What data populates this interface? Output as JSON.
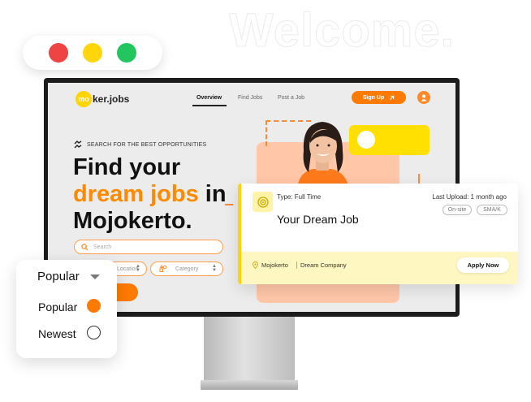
{
  "hero_banner": {
    "text": "Welcome."
  },
  "window_controls": {
    "colors": {
      "close": "#ef4444",
      "minimize": "#ffd60a",
      "maximize": "#22c55e"
    }
  },
  "app": {
    "logo": {
      "mark": "mo",
      "text": "ker.jobs"
    },
    "nav": {
      "overview": "Overview",
      "find_jobs": "Find Jobs",
      "post_job": "Post a Job"
    },
    "signup_label": "Sign Up",
    "hero": {
      "tagline": "SEARCH FOR THE BEST OPPORTUNITIES",
      "line1": "Find your",
      "highlight": "dream jobs",
      "line2_rest": " in",
      "line3": "Mojokerto."
    },
    "search": {
      "placeholder": "Search"
    },
    "filters": {
      "location": "Location",
      "category": "Category"
    }
  },
  "job_card": {
    "type": "Type: Full Time",
    "last_upload": "Last Upload: 1 month ago",
    "title": "Your Dream Job",
    "tags": [
      "On-site",
      "SMA/K"
    ],
    "location": "Mojokerto",
    "company": "Dream Company",
    "apply_label": "Apply Now"
  },
  "sort_dropdown": {
    "selected": "Popular",
    "options": [
      {
        "label": "Popular",
        "checked": true
      },
      {
        "label": "Newest",
        "checked": false
      }
    ]
  },
  "colors": {
    "accent_orange": "#ff7a00",
    "accent_yellow": "#ffd400"
  }
}
